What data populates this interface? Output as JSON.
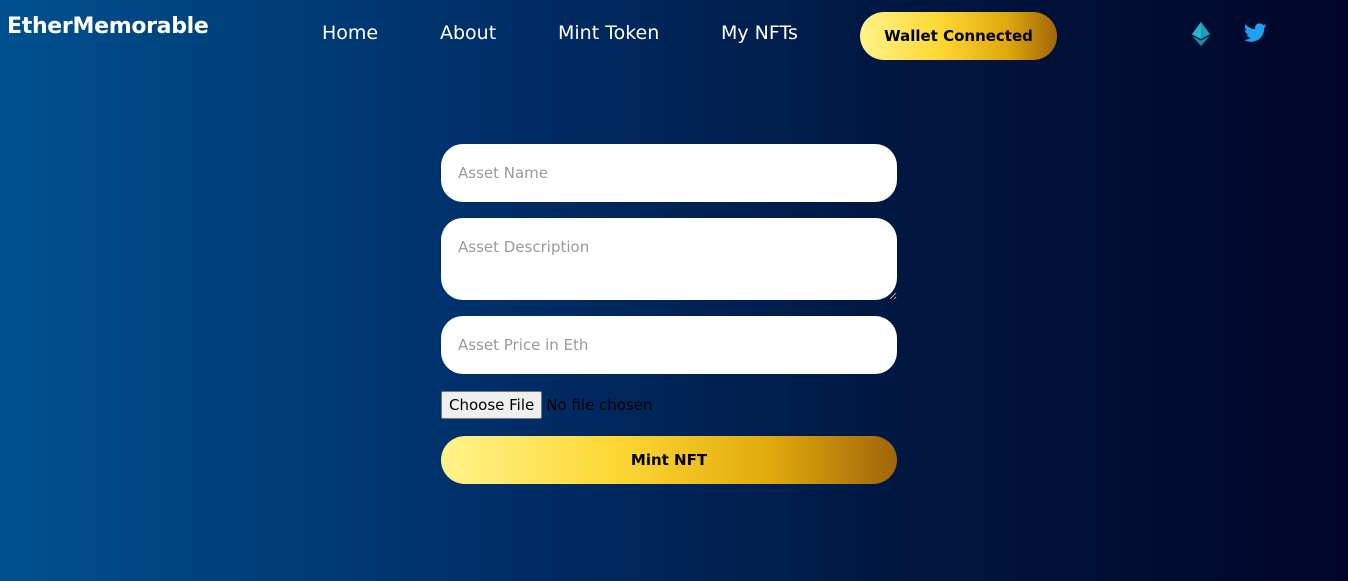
{
  "brand": {
    "name": "EtherMemorable"
  },
  "nav": {
    "items": [
      {
        "label": "Home"
      },
      {
        "label": "About"
      },
      {
        "label": "Mint Token"
      },
      {
        "label": "My NFTs"
      }
    ],
    "wallet_button": "Wallet Connected",
    "icons": [
      "ethereum-icon",
      "twitter-icon"
    ]
  },
  "form": {
    "name_placeholder": "Asset Name",
    "description_placeholder": "Asset Description",
    "price_placeholder": "Asset Price in Eth",
    "file_button": "Choose File",
    "file_status": "No file chosen",
    "submit_label": "Mint NFT"
  },
  "colors": {
    "background_start": "#00508f",
    "background_end": "#000628",
    "button_gold_light": "#fff38a",
    "button_gold_dark": "#a0650a",
    "ethereum_icon": "#1ba0b8",
    "twitter_icon": "#1da1f2"
  }
}
